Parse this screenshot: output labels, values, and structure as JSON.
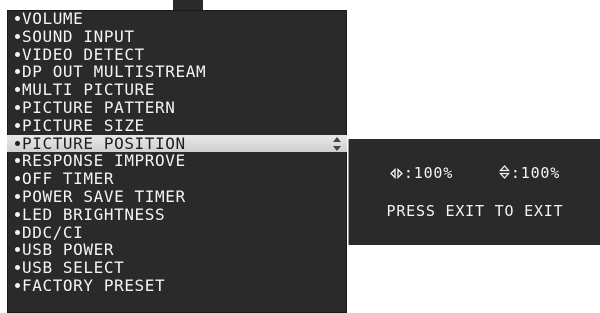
{
  "menu": {
    "items": [
      {
        "label": "VOLUME"
      },
      {
        "label": "SOUND INPUT"
      },
      {
        "label": "VIDEO DETECT"
      },
      {
        "label": "DP OUT MULTISTREAM"
      },
      {
        "label": "MULTI PICTURE"
      },
      {
        "label": "PICTURE PATTERN"
      },
      {
        "label": "PICTURE SIZE"
      },
      {
        "label": "PICTURE POSITION",
        "selected": true
      },
      {
        "label": "RESPONSE IMPROVE"
      },
      {
        "label": "OFF TIMER"
      },
      {
        "label": "POWER SAVE TIMER"
      },
      {
        "label": "LED BRIGHTNESS"
      },
      {
        "label": "DDC/CI"
      },
      {
        "label": "USB POWER"
      },
      {
        "label": "USB SELECT"
      },
      {
        "label": "FACTORY PRESET"
      }
    ]
  },
  "submenu": {
    "horizontal_value": ":100%",
    "vertical_value": ":100%",
    "exit_hint": "PRESS EXIT TO EXIT"
  },
  "colors": {
    "panel_background": "#2a2a2a",
    "text": "#f4f4f4",
    "selected_background": "#dcdcdc",
    "selected_text": "#1e1e1e"
  },
  "icons": {
    "adjust": "up-down-arrows-icon",
    "horizontal": "left-right-arrows-icon",
    "vertical": "up-down-arrows-icon"
  }
}
